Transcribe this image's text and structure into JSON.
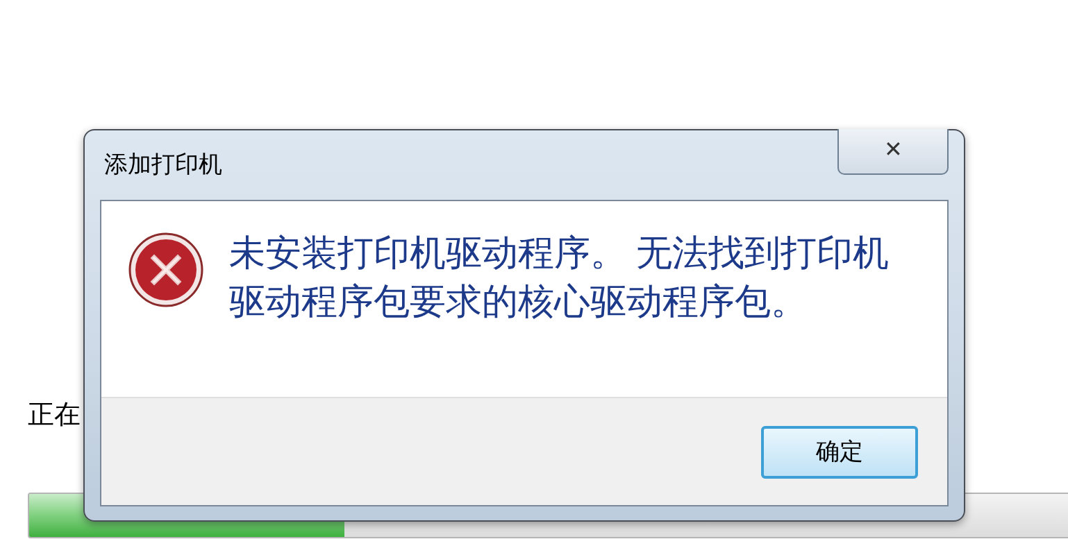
{
  "background": {
    "status_text": "正在",
    "progress": {
      "level": 0.3
    }
  },
  "dialog": {
    "title": "添加打印机",
    "close_label": "✕",
    "message": "未安装打印机驱动程序。 无法找到打印机驱动程序包要求的核心驱动程序包。",
    "buttons": [
      {
        "label": "确定",
        "default": true
      }
    ]
  }
}
